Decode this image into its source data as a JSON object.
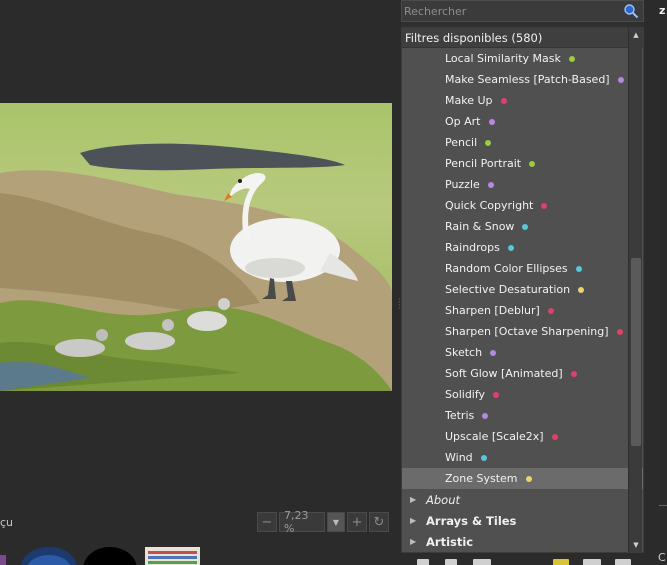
{
  "search": {
    "placeholder": "Rechercher"
  },
  "tree": {
    "header": "Filtres disponibles (580)",
    "items": [
      {
        "label": "Local Similarity Mask",
        "dot": "#9ccc3f"
      },
      {
        "label": "Make Seamless [Patch-Based]",
        "dot": "#b48ae0"
      },
      {
        "label": "Make Up",
        "dot": "#e0406a"
      },
      {
        "label": "Op Art",
        "dot": "#b48ae0"
      },
      {
        "label": "Pencil",
        "dot": "#9ccc3f"
      },
      {
        "label": "Pencil Portrait",
        "dot": "#9ccc3f"
      },
      {
        "label": "Puzzle",
        "dot": "#b48ae0"
      },
      {
        "label": "Quick Copyright",
        "dot": "#e0406a"
      },
      {
        "label": "Rain & Snow",
        "dot": "#57c7e0"
      },
      {
        "label": "Raindrops",
        "dot": "#57c7e0"
      },
      {
        "label": "Random Color Ellipses",
        "dot": "#57c7e0"
      },
      {
        "label": "Selective Desaturation",
        "dot": "#e8d66a"
      },
      {
        "label": "Sharpen [Deblur]",
        "dot": "#e0406a"
      },
      {
        "label": "Sharpen [Octave Sharpening]",
        "dot": "#e0406a"
      },
      {
        "label": "Sketch",
        "dot": "#b48ae0"
      },
      {
        "label": "Soft Glow [Animated]",
        "dot": "#e0406a"
      },
      {
        "label": "Solidify",
        "dot": "#e0406a"
      },
      {
        "label": "Tetris",
        "dot": "#b48ae0"
      },
      {
        "label": "Upscale [Scale2x]",
        "dot": "#e0406a"
      },
      {
        "label": "Wind",
        "dot": "#57c7e0"
      },
      {
        "label": "Zone System",
        "dot": "#e8d66a",
        "selected": true
      }
    ],
    "categories": [
      {
        "label": "About",
        "italic": true
      },
      {
        "label": "Arrays & Tiles",
        "italic": false
      },
      {
        "label": "Artistic",
        "italic": false
      }
    ]
  },
  "preview": {
    "zoom_value": "7,23 %",
    "label_partial": "çu"
  },
  "rightstrip": {
    "top_letter": "z",
    "bottom_letter": "C"
  }
}
